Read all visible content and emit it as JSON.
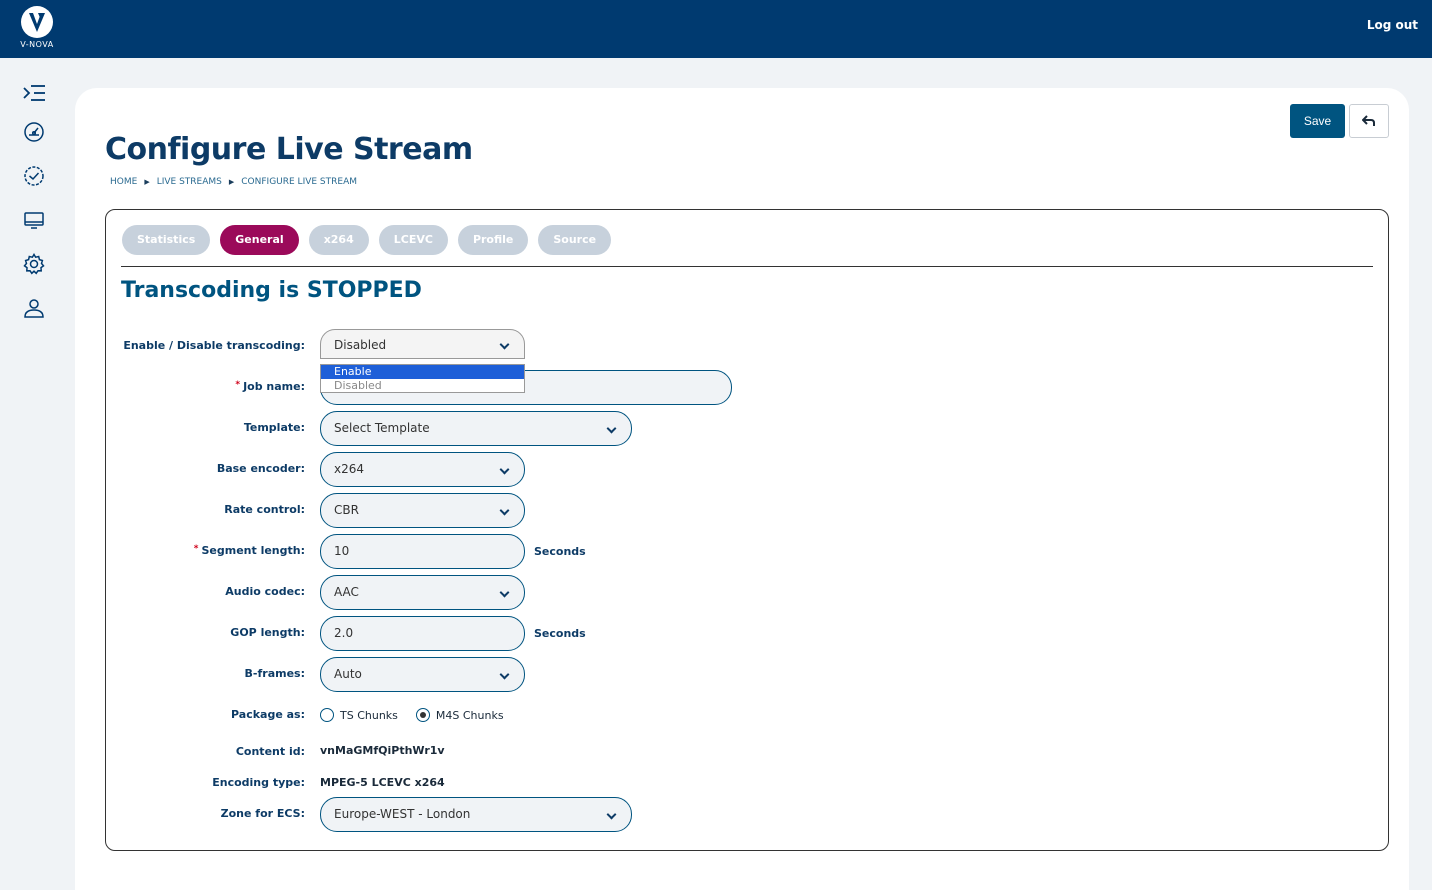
{
  "header": {
    "brand": "V-NOVA",
    "logout_label": "Log out"
  },
  "sidebar": {
    "items": [
      {
        "icon": "menu-expand-icon"
      },
      {
        "icon": "dashboard-gauge-icon"
      },
      {
        "icon": "check-circle-icon"
      },
      {
        "icon": "monitor-icon"
      },
      {
        "icon": "gear-icon"
      },
      {
        "icon": "user-icon"
      }
    ]
  },
  "toolbar": {
    "save_label": "Save",
    "back_icon": "undo-arrow-icon"
  },
  "page": {
    "title": "Configure Live Stream",
    "breadcrumb": [
      "HOME",
      "LIVE STREAMS",
      "CONFIGURE LIVE STREAM"
    ]
  },
  "tabs": [
    {
      "label": "Statistics",
      "active": false
    },
    {
      "label": "General",
      "active": true
    },
    {
      "label": "x264",
      "active": false
    },
    {
      "label": "LCEVC",
      "active": false
    },
    {
      "label": "Profile",
      "active": false
    },
    {
      "label": "Source",
      "active": false
    }
  ],
  "status_heading": "Transcoding is STOPPED",
  "form": {
    "transcoding": {
      "label": "Enable / Disable transcoding:",
      "value": "Disabled",
      "options": [
        "Enable",
        "Disabled"
      ],
      "highlighted": "Enable"
    },
    "job_name": {
      "label": "Job name:",
      "value": "",
      "required": "*"
    },
    "template": {
      "label": "Template:",
      "value": "Select Template"
    },
    "base_encoder": {
      "label": "Base encoder:",
      "value": "x264"
    },
    "rate_control": {
      "label": "Rate control:",
      "value": "CBR"
    },
    "segment_length": {
      "label": "Segment length:",
      "value": "10",
      "unit": "Seconds",
      "required": "*"
    },
    "audio_codec": {
      "label": "Audio codec:",
      "value": "AAC"
    },
    "gop_length": {
      "label": "GOP length:",
      "value": "2.0",
      "unit": "Seconds"
    },
    "b_frames": {
      "label": "B-frames:",
      "value": "Auto"
    },
    "package_as": {
      "label": "Package as:",
      "options": [
        "TS Chunks",
        "M4S Chunks"
      ],
      "selected": "M4S Chunks"
    },
    "content_id": {
      "label": "Content id:",
      "value": "vnMaGMfQiPthWr1v"
    },
    "encoding_type": {
      "label": "Encoding type:",
      "value": "MPEG-5 LCEVC x264"
    },
    "zone": {
      "label": "Zone for ECS:",
      "value": "Europe-WEST - London"
    }
  },
  "colors": {
    "header_bg": "#003a70",
    "accent": "#005480",
    "active_tab": "#9b0a5a",
    "inactive_tab": "#c7d1dc"
  }
}
